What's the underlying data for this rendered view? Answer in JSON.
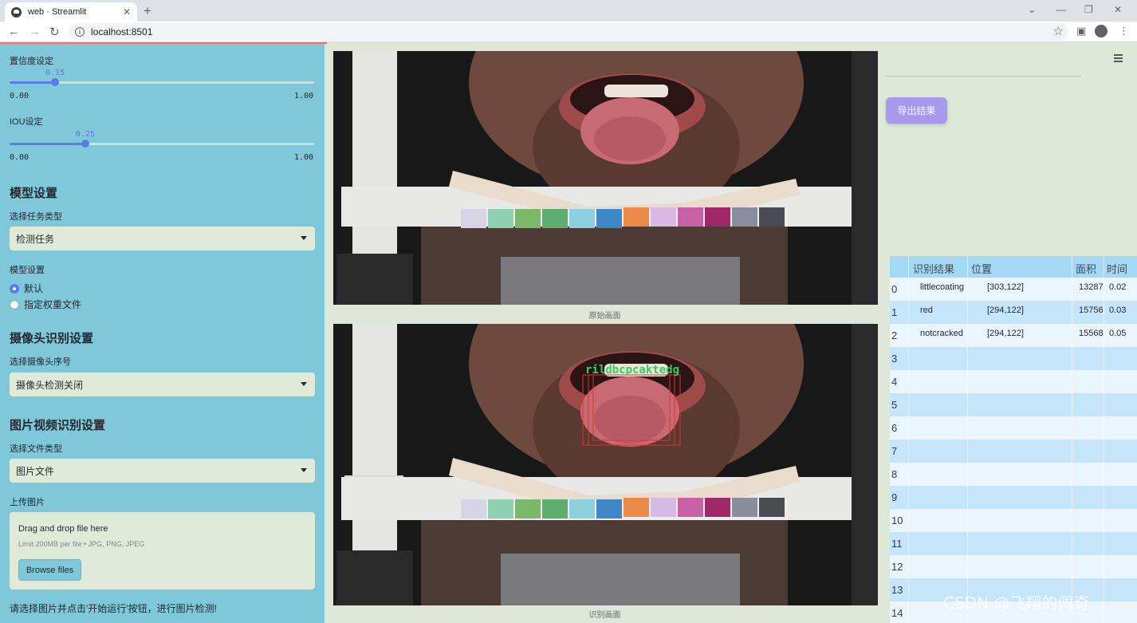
{
  "browser": {
    "tab_title": "web · Streamlit",
    "url": "localhost:8501"
  },
  "sidebar": {
    "confidence": {
      "label": "置信度设定",
      "value": "0.15",
      "fraction": 0.15,
      "min": "0.00",
      "max": "1.00"
    },
    "iou": {
      "label": "IOU设定",
      "value": "0.25",
      "fraction": 0.25,
      "min": "0.00",
      "max": "1.00"
    },
    "model_section": "模型设置",
    "task_label": "选择任务类型",
    "task_value": "检测任务",
    "model_label": "模型设置",
    "model_options": [
      "默认",
      "指定权重文件"
    ],
    "model_selected": 0,
    "camera_section": "摄像头识别设置",
    "camera_label": "选择摄像头序号",
    "camera_value": "摄像头检测关闭",
    "media_section": "图片视频识别设置",
    "filetype_label": "选择文件类型",
    "filetype_value": "图片文件",
    "upload_label": "上传图片",
    "upload_title": "Drag and drop file here",
    "upload_limit": "Limit 200MB per file • JPG, PNG, JPEG",
    "browse_label": "Browse files",
    "hint": "请选择图片并点击'开始运行'按钮，进行图片检测!"
  },
  "main": {
    "caption_original": "原始画面",
    "caption_result": "识别画面",
    "detection_overlay_text": "rildbcpcaktedg"
  },
  "right": {
    "export_label": "导出结果",
    "table": {
      "headers": [
        "识别结果",
        "位置",
        "面积",
        "时间"
      ],
      "rows": [
        {
          "idx": "0",
          "label": "littlecoating",
          "pos": "[303,122]",
          "area": "13287",
          "time": "0.02"
        },
        {
          "idx": "1",
          "label": "red",
          "pos": "[294,122]",
          "area": "15756",
          "time": "0.03"
        },
        {
          "idx": "2",
          "label": "notcracked",
          "pos": "[294,122]",
          "area": "15568",
          "time": "0.05"
        },
        {
          "idx": "3",
          "label": "",
          "pos": "",
          "area": "",
          "time": ""
        },
        {
          "idx": "4",
          "label": "",
          "pos": "",
          "area": "",
          "time": ""
        },
        {
          "idx": "5",
          "label": "",
          "pos": "",
          "area": "",
          "time": ""
        },
        {
          "idx": "6",
          "label": "",
          "pos": "",
          "area": "",
          "time": ""
        },
        {
          "idx": "7",
          "label": "",
          "pos": "",
          "area": "",
          "time": ""
        },
        {
          "idx": "8",
          "label": "",
          "pos": "",
          "area": "",
          "time": ""
        },
        {
          "idx": "9",
          "label": "",
          "pos": "",
          "area": "",
          "time": ""
        },
        {
          "idx": "10",
          "label": "",
          "pos": "",
          "area": "",
          "time": ""
        },
        {
          "idx": "11",
          "label": "",
          "pos": "",
          "area": "",
          "time": ""
        },
        {
          "idx": "12",
          "label": "",
          "pos": "",
          "area": "",
          "time": ""
        },
        {
          "idx": "13",
          "label": "",
          "pos": "",
          "area": "",
          "time": ""
        },
        {
          "idx": "14",
          "label": "",
          "pos": "",
          "area": "",
          "time": ""
        }
      ]
    }
  },
  "watermark": "CSDN @飞翔的佩奇",
  "colors": {
    "sidebar_bg": "#7ec8d9",
    "accent": "#5b7be8",
    "export_button": "#a699ee",
    "table_header": "#a4d8f5",
    "row_blue": "#c5e5fb",
    "row_light": "#ebf5fd",
    "detection_box": "#e03030",
    "detection_text": "#34d05a"
  },
  "color_chart": [
    "#d8d4e8",
    "#8fd0b2",
    "#7ab86a",
    "#5fae70",
    "#8fd0e0",
    "#3f88c8",
    "#ec8a4a",
    "#d8b8e4",
    "#c860a8",
    "#a02868",
    "#8a8e9c",
    "#4a4a52"
  ]
}
